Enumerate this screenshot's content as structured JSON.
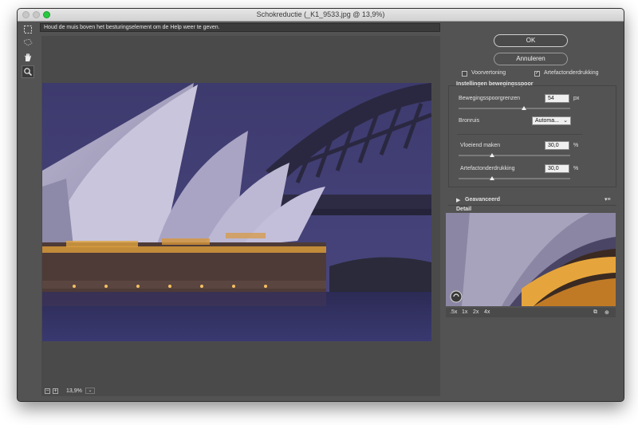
{
  "window": {
    "title": "Schokreductie (_K1_9533.jpg @ 13,9%)"
  },
  "hint": "Houd de muis boven het besturingselement om de Help weer te geven.",
  "tools": [
    {
      "icon": "marquee-icon"
    },
    {
      "icon": "lasso-icon"
    },
    {
      "icon": "hand-icon"
    },
    {
      "icon": "zoom-icon"
    }
  ],
  "status": {
    "zoom": "13,9%"
  },
  "buttons": {
    "ok": "OK",
    "cancel": "Annuleren"
  },
  "options": {
    "preview": {
      "label": "Voorvertoning",
      "checked": false
    },
    "artifact": {
      "label": "Artefactonderdrukking",
      "checked": true
    }
  },
  "trace": {
    "heading": "Instellingen bewegingsspoor",
    "limits": {
      "label": "Bewegingsspoorgrenzen",
      "value": "54",
      "unit": "px"
    },
    "noise": {
      "label": "Bronruis",
      "value": "Automa..."
    },
    "smooth": {
      "label": "Vloeiend maken",
      "value": "30,0",
      "unit": "%"
    },
    "artifact_suppression": {
      "label": "Artefactonderdrukking",
      "value": "30,0",
      "unit": "%"
    }
  },
  "advanced": {
    "label": "Geavanceerd"
  },
  "detail": {
    "label": "Detail",
    "zooms": [
      ".5x",
      "1x",
      "2x",
      "4x"
    ]
  }
}
